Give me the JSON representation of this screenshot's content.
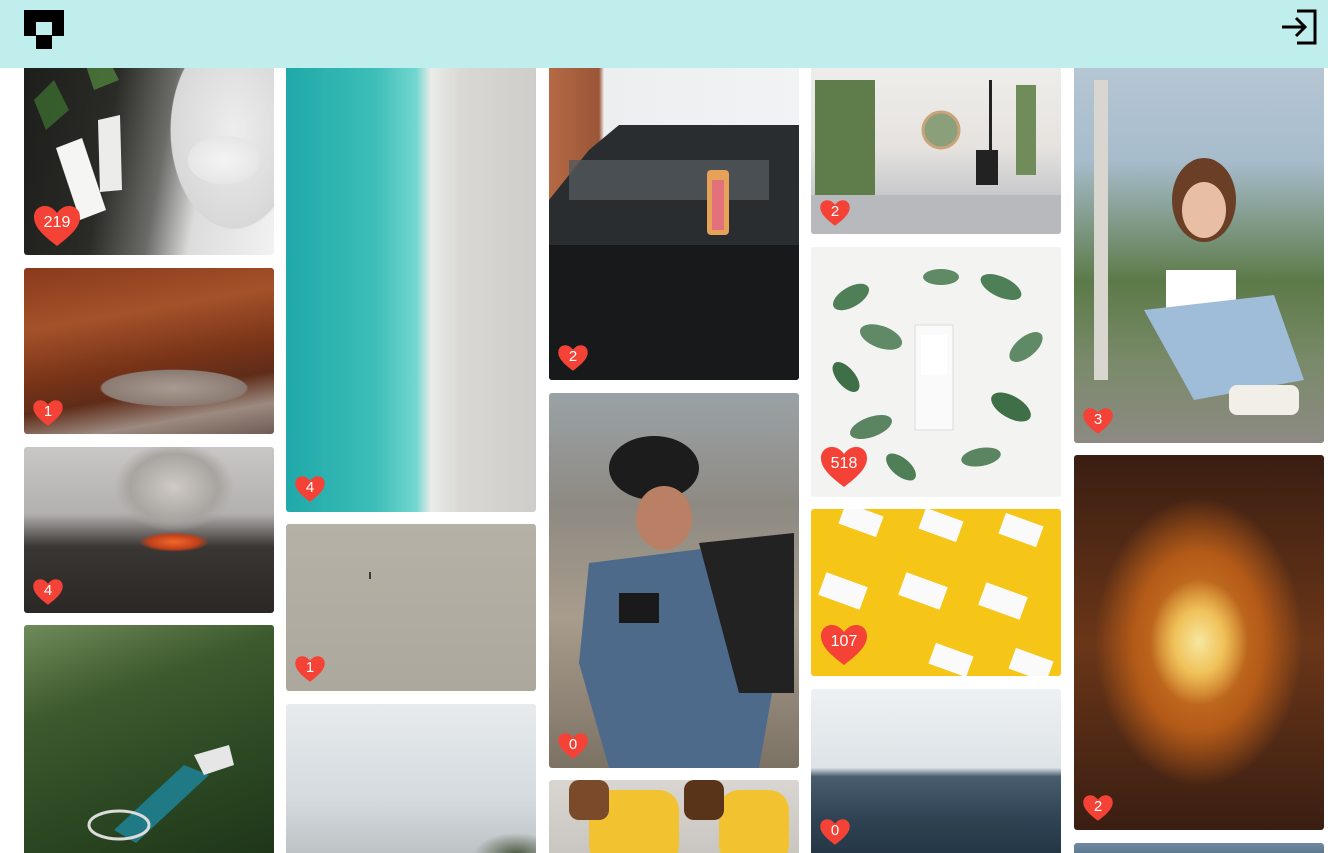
{
  "header": {
    "logo_icon": "brand-logo-icon",
    "login_icon": "sign-in-icon",
    "background": "#bfeeed"
  },
  "accent_color": "#f44336",
  "gallery": {
    "col1": [
      {
        "likes": "219",
        "subject": "Boxed Water cartons on dark soil with pine sprigs"
      },
      {
        "likes": "1",
        "subject": "Stone cairns in a red rock canyon"
      },
      {
        "likes": "4",
        "subject": "Erupting volcano with lava and smoke"
      },
      {
        "likes": "",
        "subject": "Aerial view of pool on forested hillside"
      }
    ],
    "col2": [
      {
        "likes": "4",
        "subject": "Aerial turquoise ocean shoreline"
      },
      {
        "likes": "1",
        "subject": "Lone person walking on vast sand flat"
      },
      {
        "likes": "",
        "subject": "Overcast sky over hills"
      }
    ],
    "col3": [
      {
        "likes": "2",
        "subject": "Tropical cup on pickup truck tailgate"
      },
      {
        "likes": "0",
        "subject": "Hiker in plaid shirt with backpack"
      },
      {
        "likes": "",
        "subject": "Two people in yellow with water cartons"
      }
    ],
    "col4": [
      {
        "likes": "2",
        "subject": "Minimal bedroom with round window"
      },
      {
        "likes": "518",
        "subject": "Boxed Water carton among green leaves"
      },
      {
        "likes": "107",
        "subject": "Boxed Water cartons on yellow background"
      },
      {
        "likes": "0",
        "subject": "Calm sea horizon"
      }
    ],
    "col5": [
      {
        "likes": "3",
        "subject": "Girl sitting by chain-link fence"
      },
      {
        "likes": "2",
        "subject": "Symmetric fiery abstract pattern"
      },
      {
        "likes": "",
        "subject": "Partial image"
      }
    ]
  }
}
